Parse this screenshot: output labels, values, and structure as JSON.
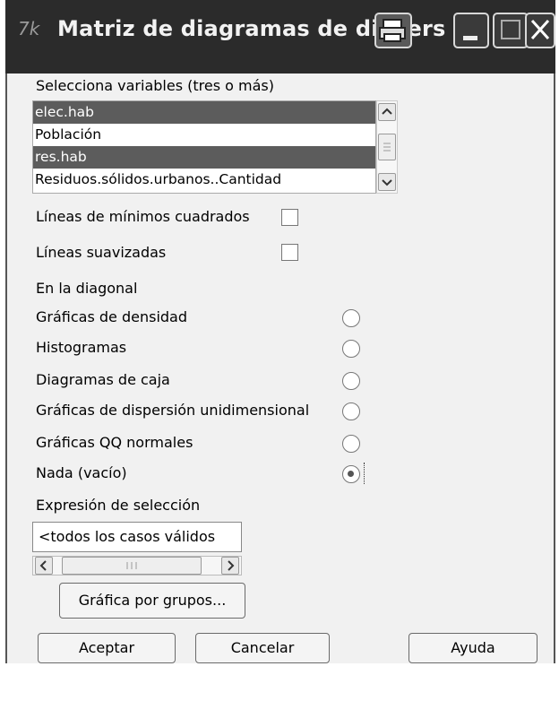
{
  "window": {
    "title": "Matriz de diagramas de dispers"
  },
  "variables": {
    "label": "Selecciona variables (tres o más)",
    "items": [
      {
        "label": "elec.hab",
        "selected": true
      },
      {
        "label": "Población",
        "selected": false
      },
      {
        "label": "res.hab",
        "selected": true
      },
      {
        "label": "Residuos.sólidos.urbanos..Cantidad",
        "selected": false
      }
    ]
  },
  "options": {
    "least_squares": {
      "label": "Líneas de mínimos cuadrados",
      "checked": false
    },
    "smooth": {
      "label": "Líneas suavizadas",
      "checked": false
    }
  },
  "diagonal": {
    "label": "En la diagonal",
    "options": [
      {
        "label": "Gráficas de densidad",
        "selected": false
      },
      {
        "label": "Histogramas",
        "selected": false
      },
      {
        "label": "Diagramas de caja",
        "selected": false
      },
      {
        "label": "Gráficas de dispersión unidimensional",
        "selected": false
      },
      {
        "label": "Gráficas QQ normales",
        "selected": false
      },
      {
        "label": "Nada (vacío)",
        "selected": true
      }
    ]
  },
  "selection": {
    "label": "Expresión de selección",
    "value": "<todos los casos válidos"
  },
  "buttons": {
    "by_groups": "Gráfica por grupos...",
    "accept": "Aceptar",
    "cancel": "Cancelar",
    "help": "Ayuda"
  }
}
